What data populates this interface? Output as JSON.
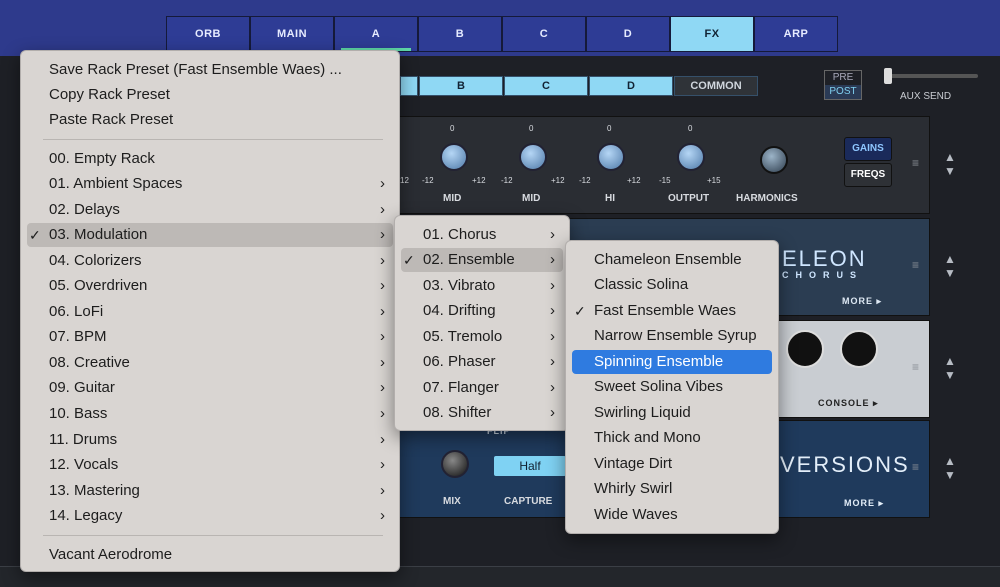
{
  "top_tabs": [
    "ORB",
    "MAIN",
    "A",
    "B",
    "C",
    "D",
    "FX",
    "ARP"
  ],
  "sub_tabs": [
    "B",
    "C",
    "D",
    "COMMON"
  ],
  "prepost": {
    "pre": "PRE",
    "post": "POST"
  },
  "aux_label": "AUX SEND",
  "eq": {
    "zeros": [
      "0",
      "0",
      "0",
      "0"
    ],
    "ranges": [
      "-12",
      "+12",
      "-12",
      "+12",
      "-12",
      "+12",
      "-15",
      "+15"
    ],
    "labels": [
      "MID",
      "MID",
      "HI",
      "OUTPUT",
      "HARMONICS"
    ],
    "left_frag": "12"
  },
  "buttons": {
    "gains": "GAINS",
    "freqs": "FREQS"
  },
  "rack2": {
    "brand": "ELEON",
    "sub": "CHORUS",
    "more": "MORE ▸"
  },
  "rack3": {
    "console": "CONSOLE ▸"
  },
  "rack4": {
    "brand": "VERSIONS",
    "more": "MORE ▸",
    "mix": "MIX",
    "capture": "CAPTURE",
    "flip": "FLIP",
    "half": "Half"
  },
  "menu1": {
    "header": [
      "Save Rack Preset (Fast Ensemble Waes) ...",
      "Copy Rack Preset",
      "Paste Rack Preset"
    ],
    "items": [
      {
        "label": "00. Empty Rack",
        "sub": false
      },
      {
        "label": "01. Ambient Spaces",
        "sub": true
      },
      {
        "label": "02. Delays",
        "sub": true
      },
      {
        "label": "03. Modulation",
        "sub": true,
        "checked": true
      },
      {
        "label": "04. Colorizers",
        "sub": true
      },
      {
        "label": "05. Overdriven",
        "sub": true
      },
      {
        "label": "06. LoFi",
        "sub": true
      },
      {
        "label": "07. BPM",
        "sub": true
      },
      {
        "label": "08. Creative",
        "sub": true
      },
      {
        "label": "09. Guitar",
        "sub": true
      },
      {
        "label": "10. Bass",
        "sub": true
      },
      {
        "label": "11. Drums",
        "sub": true
      },
      {
        "label": "12. Vocals",
        "sub": true
      },
      {
        "label": "13. Mastering",
        "sub": true
      },
      {
        "label": "14. Legacy",
        "sub": true
      }
    ],
    "footer": "Vacant Aerodrome"
  },
  "menu2": {
    "items": [
      "01. Chorus",
      "02. Ensemble",
      "03. Vibrato",
      "04. Drifting",
      "05. Tremolo",
      "06. Phaser",
      "07. Flanger",
      "08. Shifter"
    ],
    "checked": "02. Ensemble"
  },
  "menu3": {
    "items": [
      "Chameleon Ensemble",
      "Classic Solina",
      "Fast Ensemble Waes",
      "Narrow Ensemble Syrup",
      "Spinning Ensemble",
      "Sweet Solina Vibes",
      "Swirling Liquid",
      "Thick and Mono",
      "Vintage Dirt",
      "Whirly Swirl",
      "Wide Waves"
    ],
    "checked": "Fast Ensemble Waes",
    "selected": "Spinning Ensemble"
  },
  "glyphs": {
    "check": "✓",
    "chevron": "›",
    "up": "▲",
    "down": "▼",
    "grip": "≡"
  },
  "colors": {
    "tab_active": "#8fd8f4",
    "select_blue": "#2f7be0"
  }
}
